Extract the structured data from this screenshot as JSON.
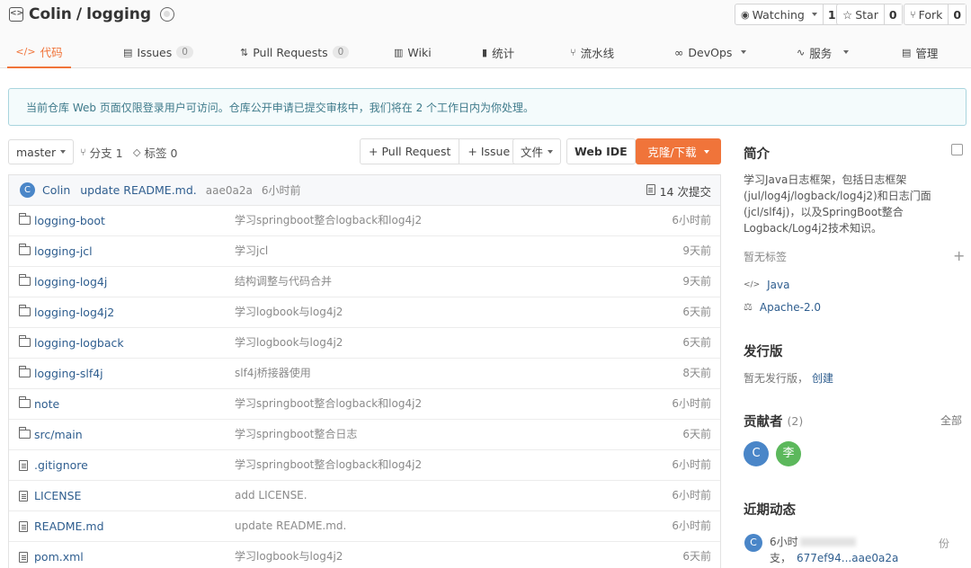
{
  "repo": {
    "owner": "Colin",
    "separator": "/",
    "name": "logging",
    "watch_label": "Watching",
    "watch_count": "1",
    "star_label": "Star",
    "star_count": "0",
    "fork_label": "Fork",
    "fork_count": "0"
  },
  "tabs": [
    {
      "label": "代码"
    },
    {
      "label": "Issues",
      "count": "0"
    },
    {
      "label": "Pull Requests",
      "count": "0"
    },
    {
      "label": "Wiki"
    },
    {
      "label": "统计"
    },
    {
      "label": "流水线"
    },
    {
      "label": "DevOps"
    },
    {
      "label": "服务"
    },
    {
      "label": "管理"
    }
  ],
  "notice": "当前仓库 Web 页面仅限登录用户可访问。仓库公开申请已提交审核中，我们将在 2 个工作日内为你处理。",
  "toolbar": {
    "branch": "master",
    "branches": "分支 1",
    "tags": "标签 0",
    "pull_request": "+ Pull Request",
    "issue": "+ Issue",
    "file": "文件",
    "web_ide": "Web IDE",
    "clone": "克隆/下载"
  },
  "commit": {
    "avatar": "C",
    "author": "Colin",
    "message": "update README.md.",
    "hash": "aae0a2a",
    "time": "6小时前",
    "count": "14 次提交"
  },
  "files": [
    {
      "type": "dir",
      "name": "logging-boot",
      "msg": "学习springboot整合logback和log4j2",
      "time": "6小时前"
    },
    {
      "type": "dir",
      "name": "logging-jcl",
      "msg": "学习jcl",
      "time": "9天前"
    },
    {
      "type": "dir",
      "name": "logging-log4j",
      "msg": "结构调整与代码合并",
      "time": "9天前"
    },
    {
      "type": "dir",
      "name": "logging-log4j2",
      "msg": "学习logbook与log4j2",
      "time": "6天前"
    },
    {
      "type": "dir",
      "name": "logging-logback",
      "msg": "学习logbook与log4j2",
      "time": "6天前"
    },
    {
      "type": "dir",
      "name": "logging-slf4j",
      "msg": "slf4j桥接器使用",
      "time": "8天前"
    },
    {
      "type": "dir",
      "name": "note",
      "msg": "学习springboot整合logback和log4j2",
      "time": "6小时前"
    },
    {
      "type": "dir",
      "name": "src/main",
      "msg": "学习springboot整合日志",
      "time": "6天前"
    },
    {
      "type": "file",
      "name": ".gitignore",
      "msg": "学习springboot整合logback和log4j2",
      "time": "6小时前"
    },
    {
      "type": "file",
      "name": "LICENSE",
      "msg": "add LICENSE.",
      "time": "6小时前"
    },
    {
      "type": "file",
      "name": "README.md",
      "msg": "update README.md.",
      "time": "6小时前"
    },
    {
      "type": "file",
      "name": "pom.xml",
      "msg": "学习logbook与log4j2",
      "time": "6天前"
    }
  ],
  "sidebar": {
    "intro_title": "简介",
    "intro_lines": [
      "学习Java日志框架，包括日志框架",
      "(jul/log4j/logback/log4j2)和日志门面",
      "(jcl/slf4j)，以及SpringBoot整合",
      "Logback/Log4j2技术知识。"
    ],
    "no_tags": "暂无标签",
    "language": "Java",
    "license": "Apache-2.0",
    "release_title": "发行版",
    "no_release": "暂无发行版，",
    "create": "创建",
    "contributors_title": "贡献者",
    "contributors_count": "(2)",
    "all": "全部",
    "contributors": [
      {
        "initial": "C",
        "color": "#4a86c8"
      },
      {
        "initial": "李",
        "color": "#5cb85c"
      }
    ],
    "activity_title": "近期动态",
    "activity_avatar": "C",
    "activity_line1": "6小时",
    "activity_line2": "支，",
    "activity_hash_range": "677ef94...aae0a2a",
    "activity_tail": "份"
  }
}
